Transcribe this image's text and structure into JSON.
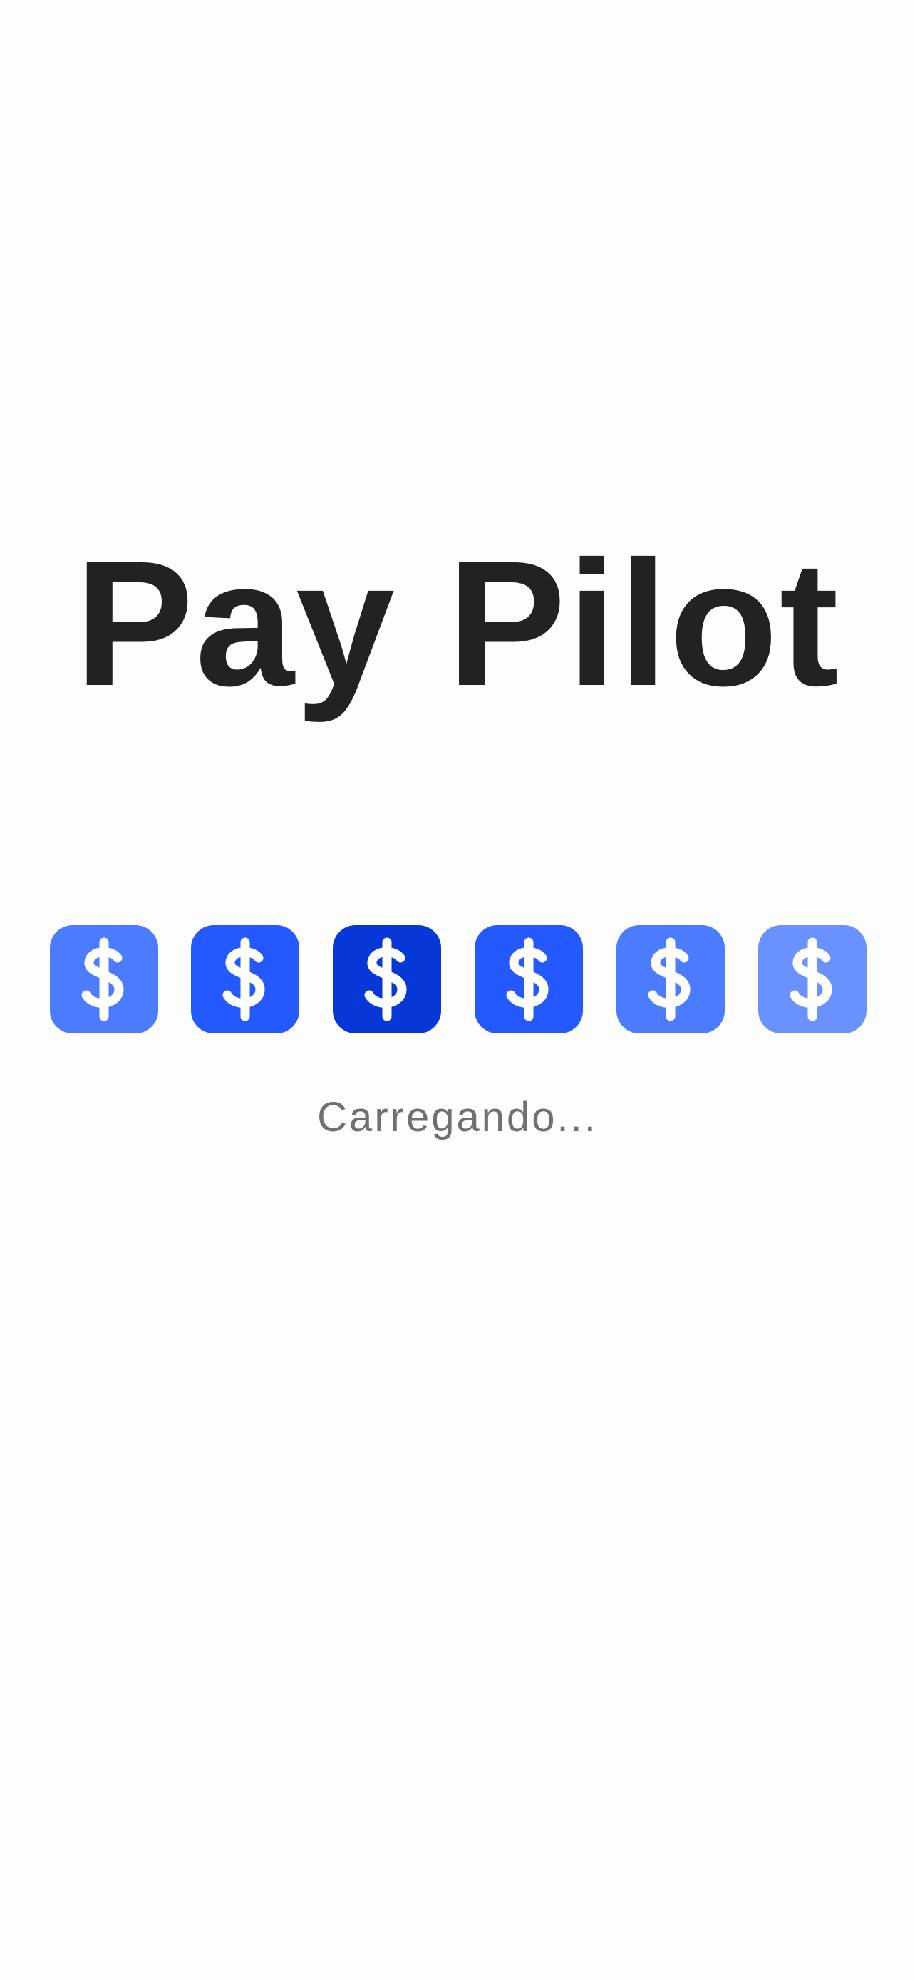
{
  "app": {
    "title": "Pay Pilot"
  },
  "loader": {
    "icon": "dollar-sign-icon",
    "tiles": [
      {
        "color": "#4b7bff"
      },
      {
        "color": "#2459ff"
      },
      {
        "color": "#0538d6"
      },
      {
        "color": "#2459ff"
      },
      {
        "color": "#4b7bff"
      },
      {
        "color": "#6a92ff"
      }
    ]
  },
  "status": {
    "loading_text": "Carregando..."
  }
}
